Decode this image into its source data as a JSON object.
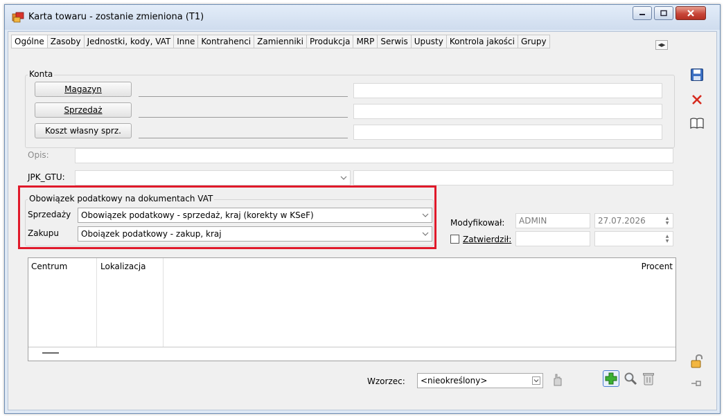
{
  "window": {
    "title": "Karta towaru - zostanie zmieniona (T1)"
  },
  "tabs": [
    {
      "label": "Ogólne"
    },
    {
      "label": "Zasoby"
    },
    {
      "label": "Jednostki, kody, VAT"
    },
    {
      "label": "Inne"
    },
    {
      "label": "Kontrahenci"
    },
    {
      "label": "Zamienniki"
    },
    {
      "label": "Produkcja"
    },
    {
      "label": "MRP"
    },
    {
      "label": "Serwis"
    },
    {
      "label": "Upusty"
    },
    {
      "label": "Kontrola jakości"
    },
    {
      "label": "Grupy"
    }
  ],
  "konta": {
    "group_label": "Konta",
    "magazyn_label": "Magazyn",
    "sprzedaz_label": "Sprzedaż",
    "koszt_label": "Koszt własny sprz.",
    "magazyn_value": "",
    "magazyn_desc": "",
    "sprzedaz_value": "",
    "sprzedaz_desc": "",
    "koszt_value": "",
    "koszt_desc": ""
  },
  "opis": {
    "label": "Opis:",
    "value": ""
  },
  "jpk": {
    "label": "JPK_GTU:",
    "value": "",
    "desc": ""
  },
  "obowiazek": {
    "group_label": "Obowiązek podatkowy na dokumentach VAT",
    "sprzedazy_label": "Sprzedaży",
    "sprzedazy_value": "Obowiązek podatkowy  -  sprzedaż, kraj (korekty w KSeF)",
    "zakupu_label": "Zakupu",
    "zakupu_value": "Oboiązek  podatkowy - zakup, kraj"
  },
  "modyfikacja": {
    "modyfikowal_label": "Modyfikował:",
    "modyfikowal_user": "ADMIN",
    "modyfikowal_date": "27.07.2026",
    "zatwierdzil_label": "Zatwierdził:",
    "zatwierdzil_user": "",
    "zatwierdzil_date": ""
  },
  "table": {
    "columns": [
      "Centrum",
      "Lokalizacja",
      "Procent"
    ],
    "rows": []
  },
  "bottom": {
    "wzorzec_label": "Wzorzec:",
    "wzorzec_value": "<nieokreślony>"
  },
  "colors": {
    "highlight": "#e0192a",
    "save": "#2e5fa8",
    "cancel": "#d62a1e",
    "add": "#2fa82a"
  },
  "icons": [
    "save-icon",
    "cancel-icon",
    "book-icon",
    "unlock-icon",
    "pin-icon",
    "add-icon",
    "search-icon",
    "trash-icon",
    "hand-icon"
  ]
}
